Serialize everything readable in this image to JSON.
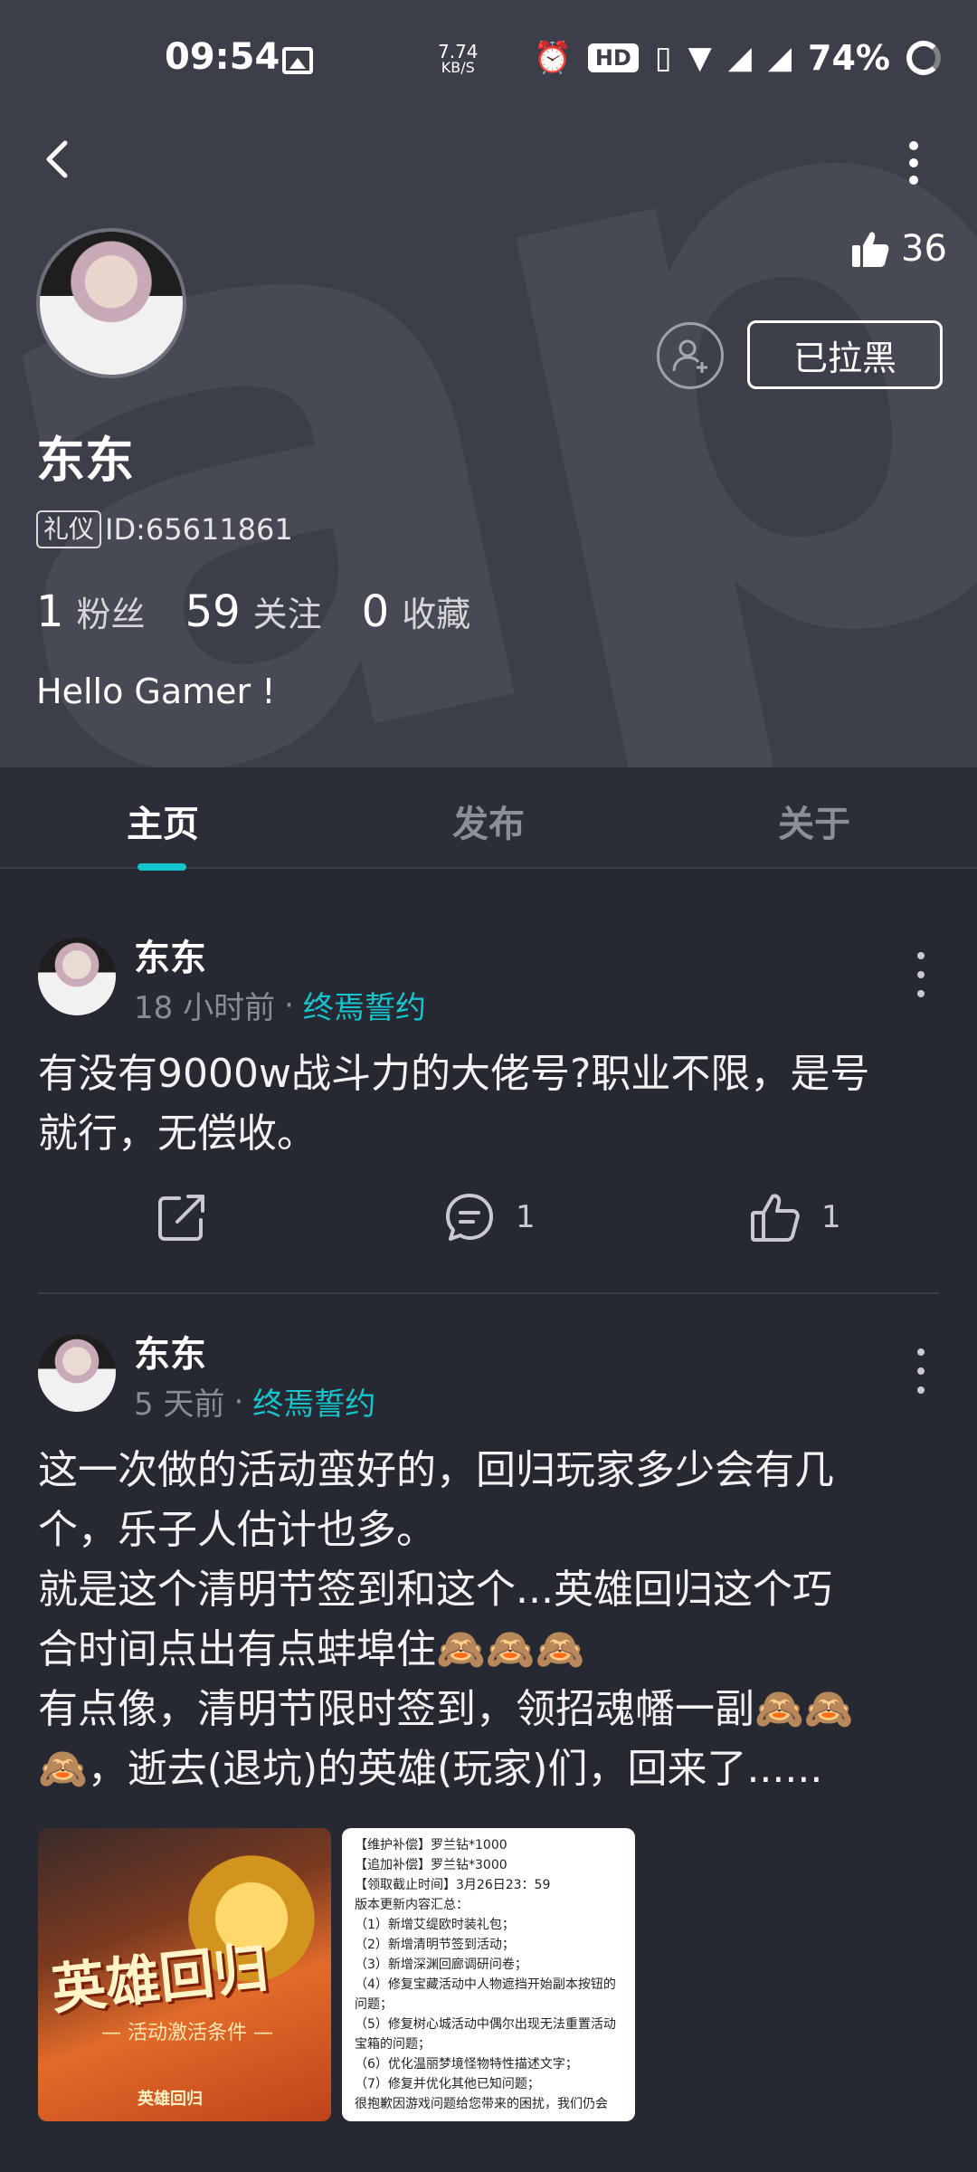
{
  "status_bar": {
    "time": "09:54",
    "net_speed_value": "7.74",
    "net_speed_unit": "KB/S",
    "hd_label": "HD",
    "battery": "74%"
  },
  "profile": {
    "likes": "36",
    "block_button_label": "已拉黑",
    "name": "东东",
    "badge": "礼仪",
    "id_text": "ID:65611861",
    "stats": [
      {
        "num": "1",
        "label": "粉丝"
      },
      {
        "num": "59",
        "label": "关注"
      },
      {
        "num": "0",
        "label": "收藏"
      }
    ],
    "bio": "Hello Gamer !"
  },
  "tabs": [
    {
      "label": "主页",
      "active": true
    },
    {
      "label": "发布",
      "active": false
    },
    {
      "label": "关于",
      "active": false
    }
  ],
  "posts": [
    {
      "author": "东东",
      "time": "18 小时前",
      "dot": "·",
      "group": "终焉誓约",
      "text": "有没有9000w战斗力的大佬号?职业不限，是号\n就行，无偿收。",
      "comments": "1",
      "likes": "1"
    },
    {
      "author": "东东",
      "time": "5 天前",
      "dot": "·",
      "group": "终焉誓约",
      "text": "这一次做的活动蛮好的，回归玩家多少会有几\n个，乐子人估计也多。\n就是这个清明节签到和这个...英雄回归这个巧\n合时间点出有点蚌埠住🙈🙈🙈\n有点像，清明节限时签到，领招魂幡一副🙈🙈\n🙈，逝去(退坑)的英雄(玩家)们，回来了......",
      "image_a_title": "英雄回归",
      "image_a_subtitle": "— 活动激活条件 —",
      "image_a_footer": "英雄回归",
      "image_b_text": "【维护补偿】罗兰钻*1000\n【追加补偿】罗兰钻*3000\n【领取截止时间】3月26日23：59\n版本更新内容汇总：\n（1）新增艾缇欧时装礼包；\n（2）新增清明节签到活动；\n（3）新增深渊回廊调研问卷；\n（4）修复宝藏活动中人物遮挡开始副本按钮的问题；\n（5）修复树心城活动中偶尔出现无法重置活动宝箱的问题；\n（6）优化温丽梦境怪物特性描述文字；\n（7）修复并优化其他已知问题；\n很抱歉因游戏问题给您带来的困扰，我们仍会"
    }
  ]
}
